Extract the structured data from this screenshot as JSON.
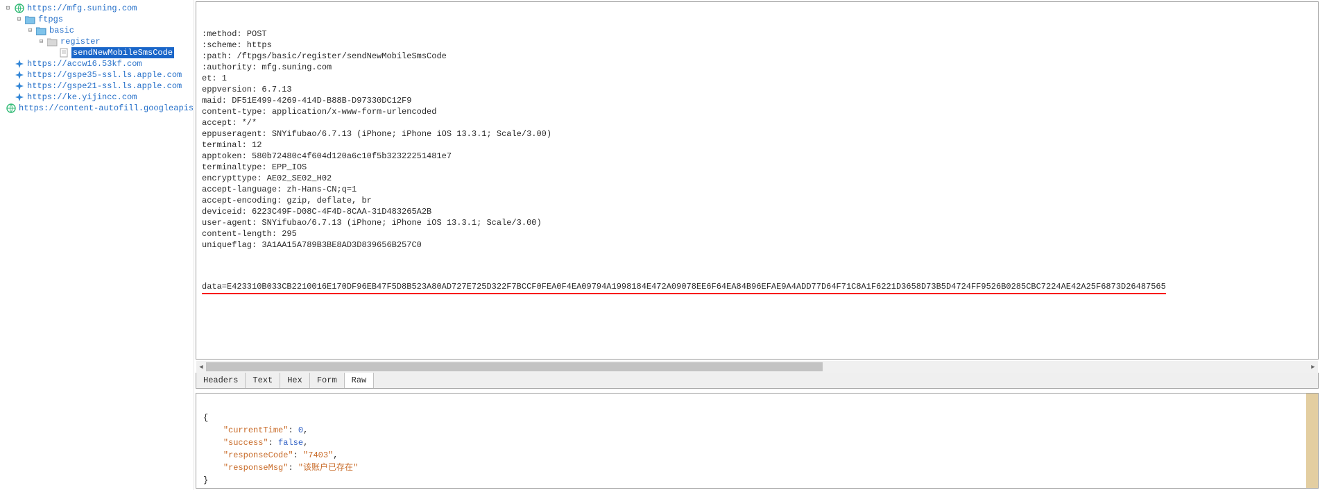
{
  "tree": {
    "hosts": [
      {
        "label": "https://mfg.suning.com",
        "icon": "globe",
        "expandable": "minus",
        "children": [
          {
            "label": "ftpgs",
            "icon": "folder",
            "expandable": "minus",
            "children": [
              {
                "label": "basic",
                "icon": "folder",
                "expandable": "minus",
                "children": [
                  {
                    "label": "register",
                    "icon": "folder-plain",
                    "expandable": "minus",
                    "children": [
                      {
                        "label": "sendNewMobileSmsCode",
                        "icon": "page",
                        "selected": true
                      }
                    ]
                  }
                ]
              }
            ]
          }
        ]
      },
      {
        "label": "https://accw16.53kf.com",
        "icon": "spark"
      },
      {
        "label": "https://gspe35-ssl.ls.apple.com",
        "icon": "spark"
      },
      {
        "label": "https://gspe21-ssl.ls.apple.com",
        "icon": "spark"
      },
      {
        "label": "https://ke.yijincc.com",
        "icon": "spark"
      },
      {
        "label": "https://content-autofill.googleapis.c",
        "icon": "globe"
      }
    ]
  },
  "request": {
    "lines": [
      ":method: POST",
      ":scheme: https",
      ":path: /ftpgs/basic/register/sendNewMobileSmsCode",
      ":authority: mfg.suning.com",
      "et: 1",
      "eppversion: 6.7.13",
      "maid: DF51E499-4269-414D-B88B-D97330DC12F9",
      "content-type: application/x-www-form-urlencoded",
      "accept: */*",
      "eppuseragent: SNYifubao/6.7.13 (iPhone; iPhone iOS 13.3.1; Scale/3.00)",
      "terminal: 12",
      "apptoken: 580b72480c4f604d120a6c10f5b32322251481e7",
      "terminaltype: EPP_IOS",
      "encrypttype: AE02_SE02_H02",
      "accept-language: zh-Hans-CN;q=1",
      "accept-encoding: gzip, deflate, br",
      "deviceid: 6223C49F-D08C-4F4D-8CAA-31D483265A2B",
      "user-agent: SNYifubao/6.7.13 (iPhone; iPhone iOS 13.3.1; Scale/3.00)",
      "content-length: 295",
      "uniqueflag: 3A1AA15A789B3BE8AD3D839656B257C0"
    ],
    "data": "data=E423310B033CB2210016E170DF96EB47F5D8B523A80AD727E725D322F7BCCF0FEA0F4EA09794A1998184E472A09078EE6F64EA84B96EFAE9A4ADD77D64F71C8A1F6221D3658D73B5D4724FF9526B0285CBC7224AE42A25F6873D26487565"
  },
  "tabs": {
    "headers": "Headers",
    "text": "Text",
    "hex": "Hex",
    "form": "Form",
    "raw": "Raw"
  },
  "response": {
    "currentTime": 0,
    "success": false,
    "responseCode": "7403",
    "responseMsg": "该账户已存在"
  },
  "labels": {
    "currentTime": "currentTime",
    "success": "success",
    "responseCode": "responseCode",
    "responseMsg": "responseMsg"
  }
}
